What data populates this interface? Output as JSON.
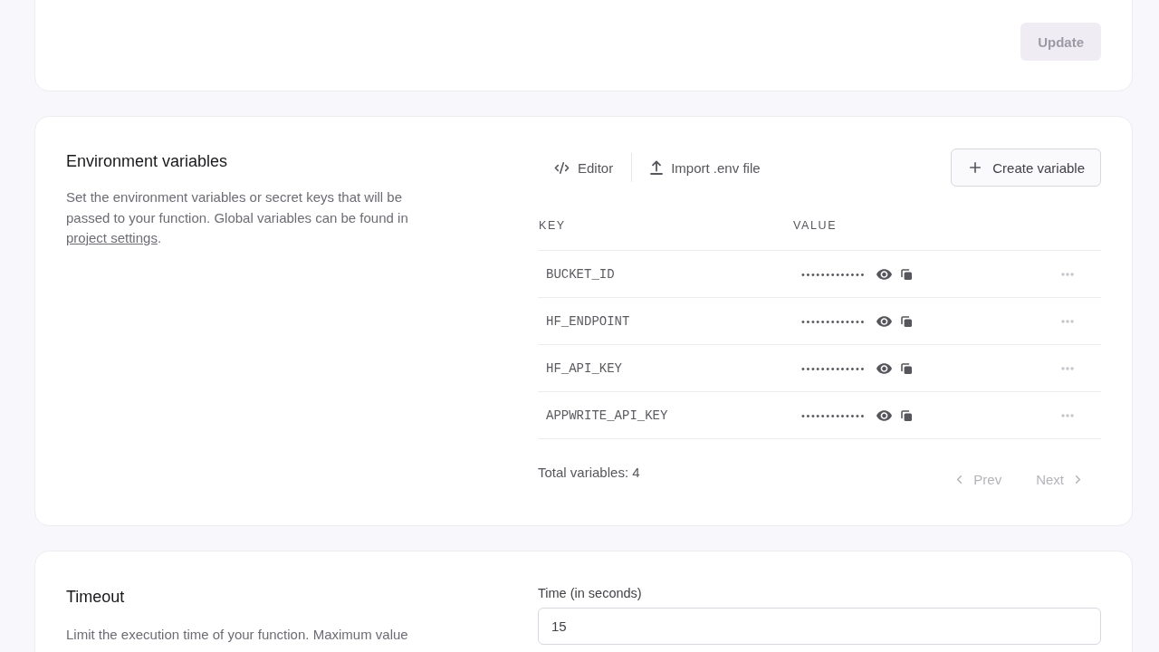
{
  "top_card": {
    "update_button": {
      "label": "Update",
      "disabled": true
    }
  },
  "environment_variables": {
    "title": "Environment variables",
    "description": {
      "text": "Set the environment variables or secret keys that will be passed to your function. Global variables can be found in",
      "link": "project settings",
      "end": "."
    },
    "toolbar": [
      {
        "kind": "editor",
        "label": "Editor"
      },
      {
        "kind": "import",
        "label": "Import .env file"
      }
    ],
    "create_button": {
      "label": "Create variable"
    },
    "table": {
      "columns": [
        "KEY",
        "VALUE"
      ],
      "rows": [
        {
          "key": "BUCKET_ID",
          "value": "•••••••••••••"
        },
        {
          "key": "HF_ENDPOINT",
          "value": "•••••••••••••"
        },
        {
          "key": "HF_API_KEY",
          "value": "•••••••••••••"
        },
        {
          "key": "APPWRITE_API_KEY",
          "value": "•••••••••••••"
        }
      ]
    },
    "total": "Total variables: 4",
    "pagination": [
      {
        "kind": "prev",
        "label": "Prev",
        "disabled": true
      },
      {
        "kind": "next",
        "label": "Next",
        "disabled": true
      }
    ]
  },
  "timeout": {
    "title": "Timeout",
    "description": "Limit the execution time of your function. Maximum value",
    "field": {
      "label": "Time (in seconds)",
      "value": "15"
    }
  }
}
